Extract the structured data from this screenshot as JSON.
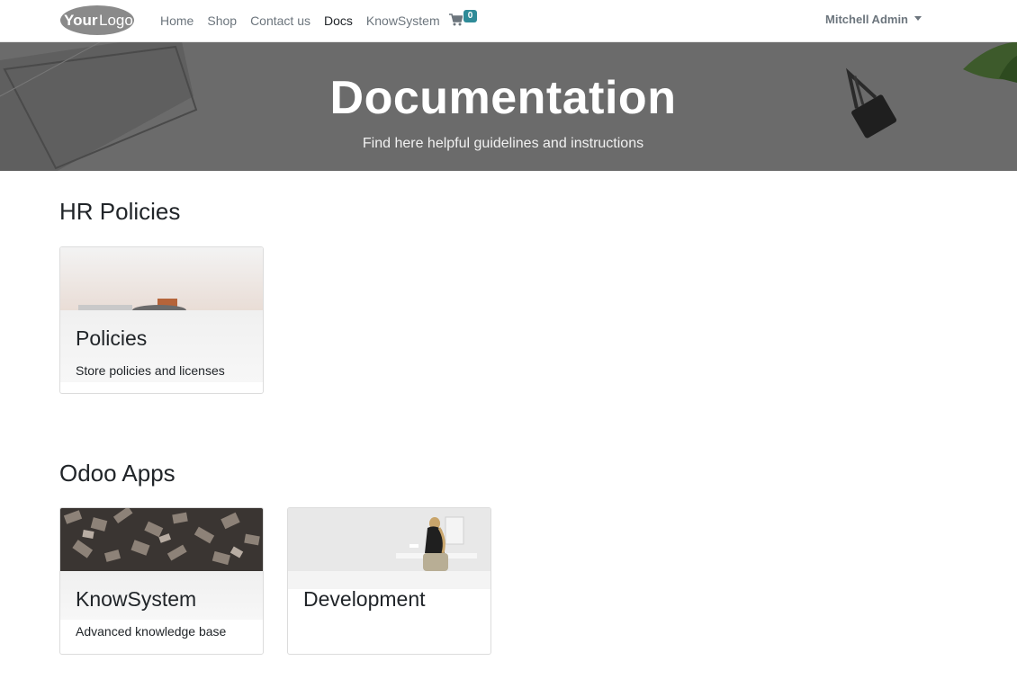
{
  "navbar": {
    "logo_text_bold": "Your",
    "logo_text": "Logo",
    "links": [
      "Home",
      "Shop",
      "Contact us",
      "Docs",
      "KnowSystem"
    ],
    "active_link": "Docs",
    "cart_count": "0",
    "user_name": "Mitchell Admin"
  },
  "hero": {
    "title": "Documentation",
    "subtitle": "Find here helpful guidelines and instructions"
  },
  "sections": [
    {
      "title": "HR Policies",
      "cards": [
        {
          "title": "Policies",
          "description": "Store policies and licenses"
        }
      ]
    },
    {
      "title": "Odoo Apps",
      "cards": [
        {
          "title": "KnowSystem",
          "description": "Advanced knowledge base"
        },
        {
          "title": "Development",
          "description": ""
        }
      ]
    }
  ],
  "colors": {
    "accent": "#2f8b98",
    "hero_bg": "#6b6b6b"
  }
}
